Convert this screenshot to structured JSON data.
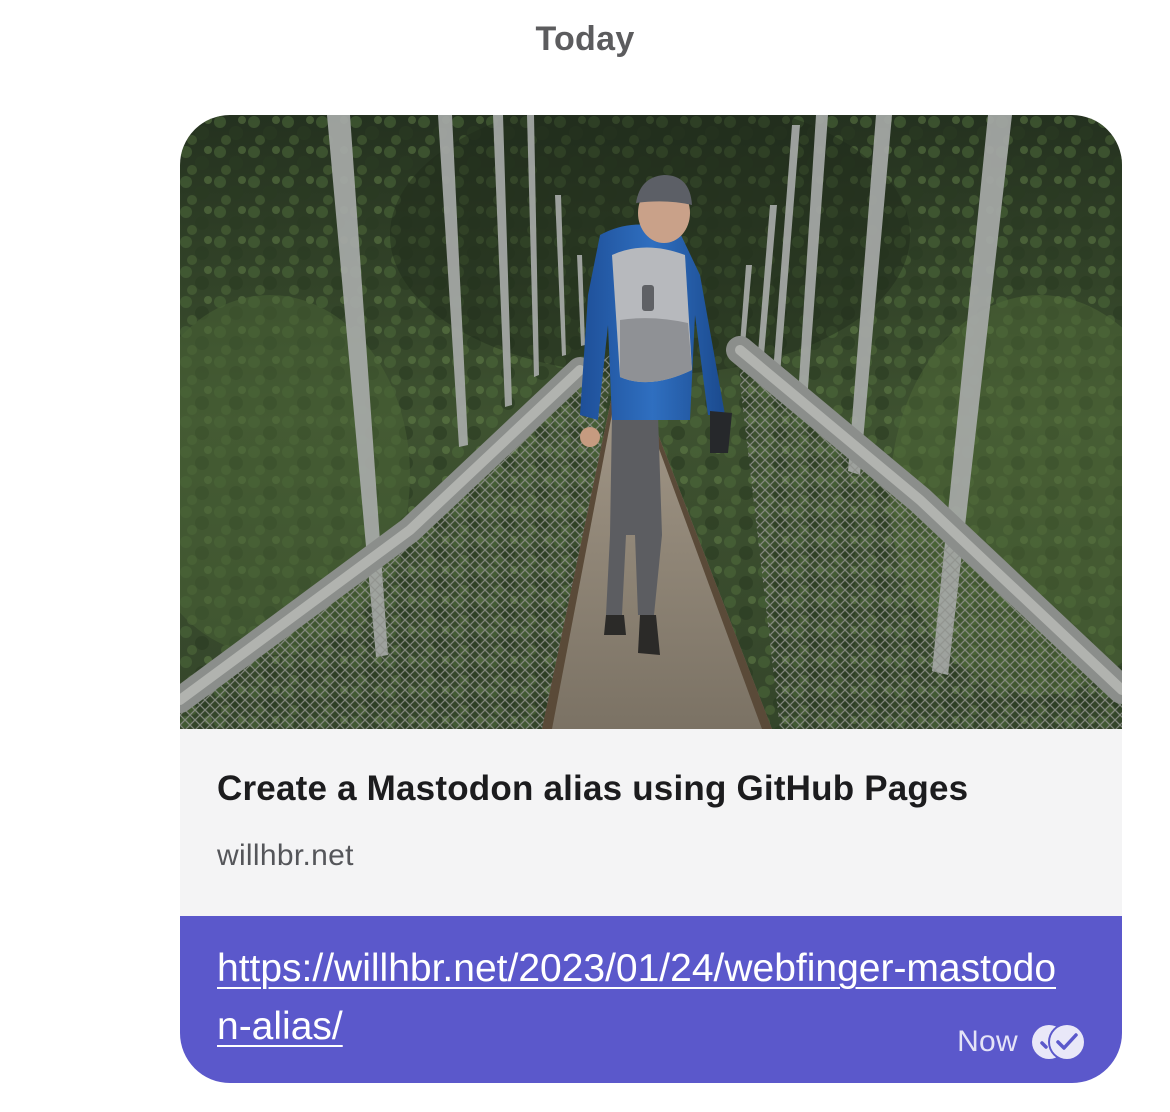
{
  "date_separator": "Today",
  "message": {
    "link_preview": {
      "image": "suspension-bridge-hiker-photo",
      "title": "Create a Mastodon alias using GitHub Pages",
      "domain": "willhbr.net"
    },
    "url_text": "https://willhbr.net/2023/01/24/webfinger-mastodon-alias/",
    "timestamp": "Now",
    "status_icon": "read-receipt-icon",
    "bubble_color": "#5b58cb"
  }
}
